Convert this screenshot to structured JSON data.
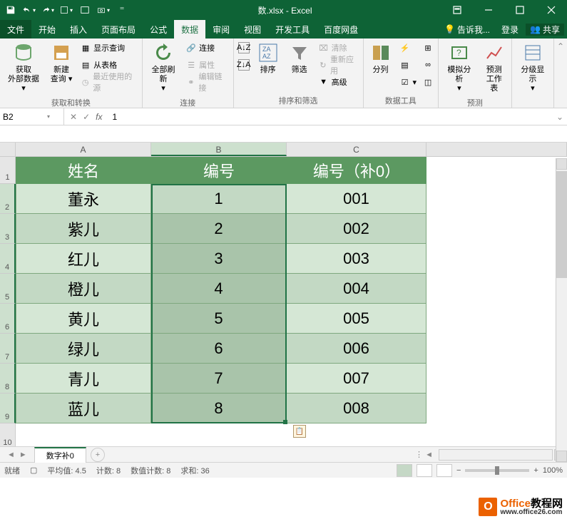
{
  "titlebar": {
    "title": "数.xlsx - Excel"
  },
  "tabs": {
    "file": "文件",
    "items": [
      "开始",
      "插入",
      "页面布局",
      "公式",
      "数据",
      "审阅",
      "视图",
      "开发工具",
      "百度网盘"
    ],
    "active": "数据",
    "tell_me": "告诉我...",
    "signin": "登录",
    "share": "共享"
  },
  "ribbon": {
    "group1": {
      "btn1_l1": "获取",
      "btn1_l2": "外部数据",
      "btn2_l1": "新建",
      "btn2_l2": "查询",
      "icon1": "显示查询",
      "icon2": "从表格",
      "icon3": "最近使用的源",
      "label": "获取和转换"
    },
    "group2": {
      "btn1_l1": "全部刷新",
      "opt1": "连接",
      "opt2": "属性",
      "opt3": "编辑链接",
      "label": "连接"
    },
    "group3": {
      "btn1": "排序",
      "btn2": "筛选",
      "opt1": "清除",
      "opt2": "重新应用",
      "opt3": "高级",
      "label": "排序和筛选"
    },
    "group4": {
      "btn1": "分列",
      "label": "数据工具"
    },
    "group5": {
      "btn1": "模拟分析",
      "btn2_l1": "预测",
      "btn2_l2": "工作表",
      "label": "预测"
    },
    "group6": {
      "btn1": "分级显示"
    }
  },
  "formula_bar": {
    "name_box": "B2",
    "formula": "1"
  },
  "columns": [
    "A",
    "B",
    "C"
  ],
  "row_numbers": [
    "1",
    "2",
    "3",
    "4",
    "5",
    "6",
    "7",
    "8",
    "9",
    "10"
  ],
  "headers": {
    "A": "姓名",
    "B": "编号",
    "C": "编号（补0）"
  },
  "rows": [
    {
      "name": "董永",
      "num": "1",
      "pad": "001"
    },
    {
      "name": "紫儿",
      "num": "2",
      "pad": "002"
    },
    {
      "name": "红儿",
      "num": "3",
      "pad": "003"
    },
    {
      "name": "橙儿",
      "num": "4",
      "pad": "004"
    },
    {
      "name": "黄儿",
      "num": "5",
      "pad": "005"
    },
    {
      "name": "绿儿",
      "num": "6",
      "pad": "006"
    },
    {
      "name": "青儿",
      "num": "7",
      "pad": "007"
    },
    {
      "name": "蓝儿",
      "num": "8",
      "pad": "008"
    }
  ],
  "sheet_tab": "数字补0",
  "status": {
    "ready": "就绪",
    "avg_label": "平均值:",
    "avg": "4.5",
    "count_label": "计数:",
    "count": "8",
    "numcount_label": "数值计数:",
    "numcount": "8",
    "sum_label": "求和:",
    "sum": "36",
    "zoom": "100%"
  },
  "watermark": {
    "brand": "Office",
    "suffix": "教程网",
    "url": "www.office26.com"
  }
}
